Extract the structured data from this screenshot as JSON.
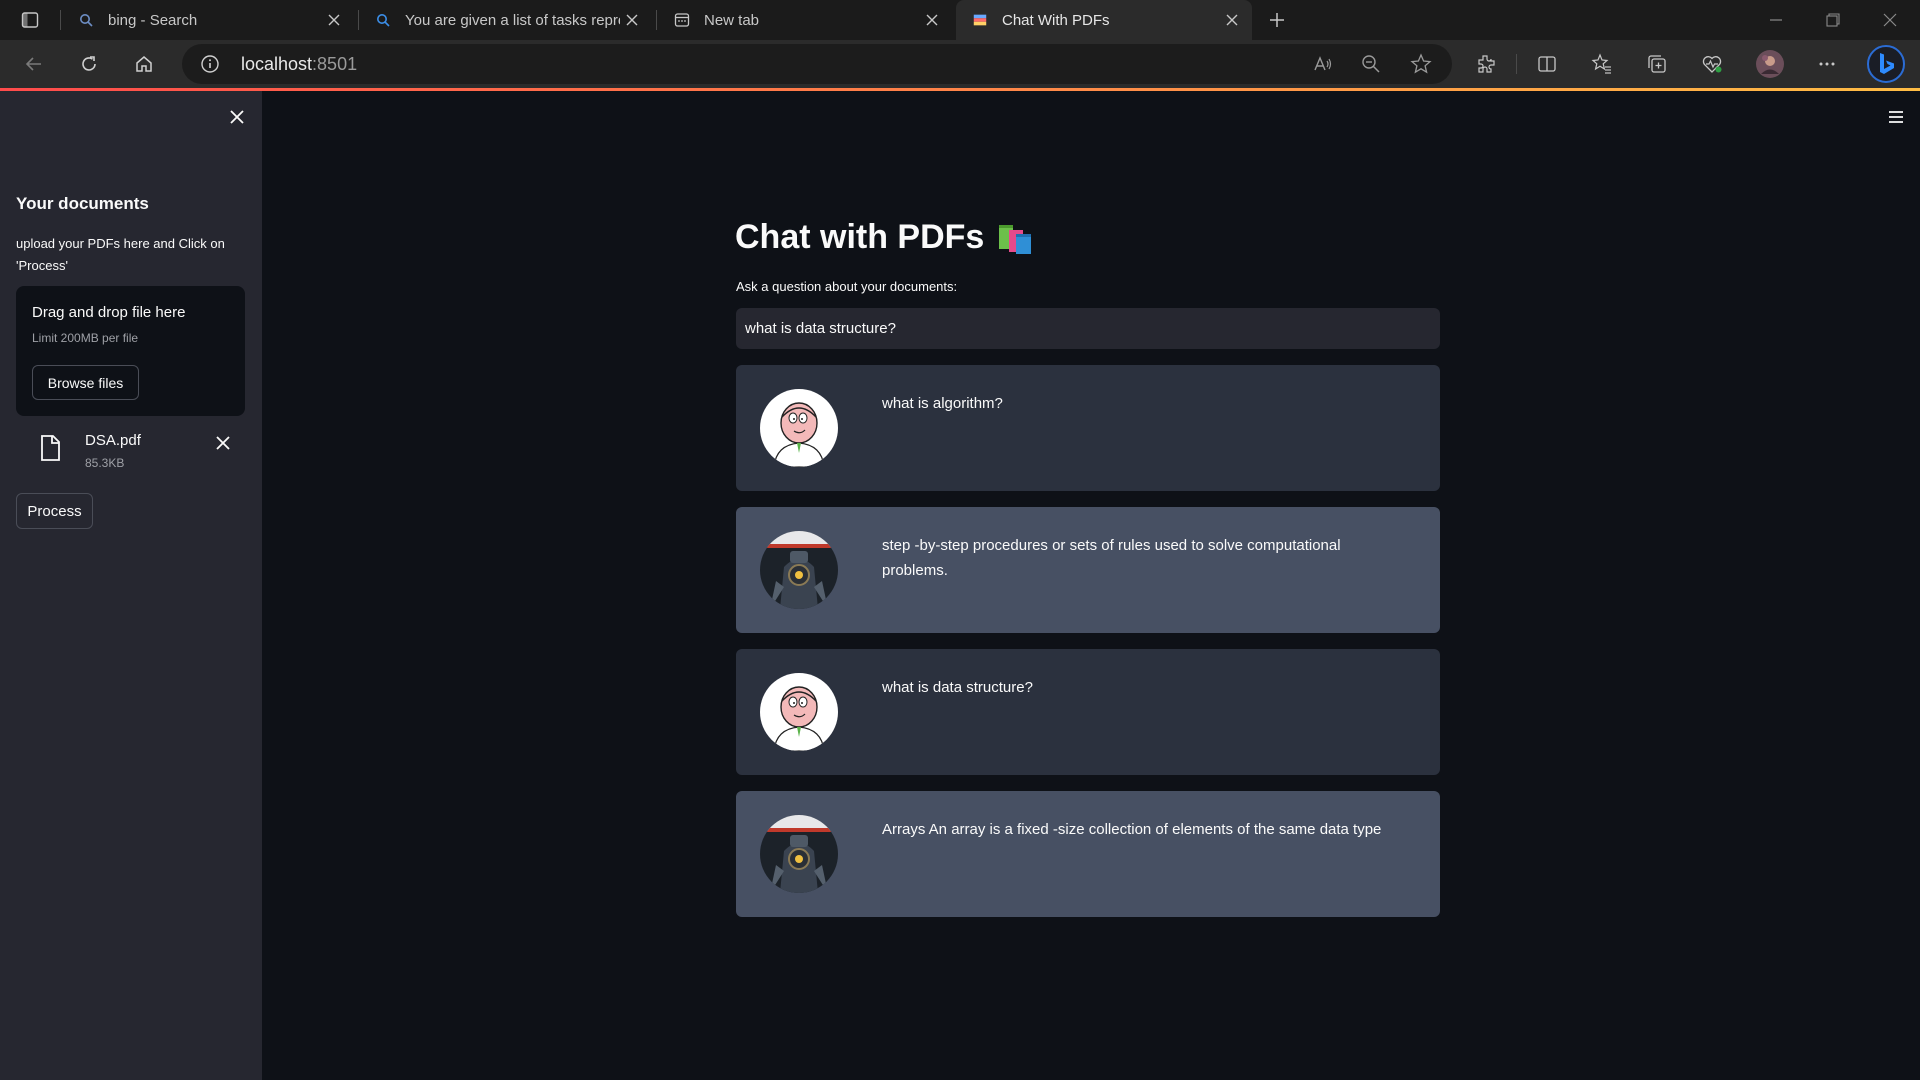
{
  "browser": {
    "tabs": [
      {
        "title": "bing - Search",
        "icon": "search-icon"
      },
      {
        "title": "You are given a list of tasks repre",
        "icon": "search-icon"
      },
      {
        "title": "New tab",
        "icon": "new-tab-icon"
      },
      {
        "title": "Chat With PDFs",
        "icon": "app-favicon"
      }
    ],
    "url_host": "localhost",
    "url_port": ":8501",
    "colors": {
      "chrome_bg": "#202124",
      "active_tab": "#2b2b2b",
      "progress_start": "#ff4b4b",
      "progress_end": "#ffbd45"
    }
  },
  "sidebar": {
    "title": "Your documents",
    "description": "upload your PDFs here and Click on 'Process'",
    "dropzone": {
      "title": "Drag and drop file here",
      "limit": "Limit 200MB per file",
      "browse_label": "Browse files"
    },
    "file": {
      "name": "DSA.pdf",
      "size": "85.3KB"
    },
    "process_label": "Process"
  },
  "main": {
    "title": "Chat with PDFs",
    "title_emoji": "books-icon",
    "question_label": "Ask a question about your documents:",
    "question_value": "what is data structure?",
    "messages": [
      {
        "role": "user",
        "text": "what is algorithm?"
      },
      {
        "role": "bot",
        "text": "step -by-step procedures or sets of rules used to solve computational problems."
      },
      {
        "role": "user",
        "text": "what is data structure?"
      },
      {
        "role": "bot",
        "text": "Arrays An array is a fixed -size collection of elements of the same data type"
      }
    ],
    "colors": {
      "user_bubble": "#2b313e",
      "bot_bubble": "#475063",
      "sidebar_bg": "#262730",
      "page_bg": "#0e1117"
    }
  }
}
